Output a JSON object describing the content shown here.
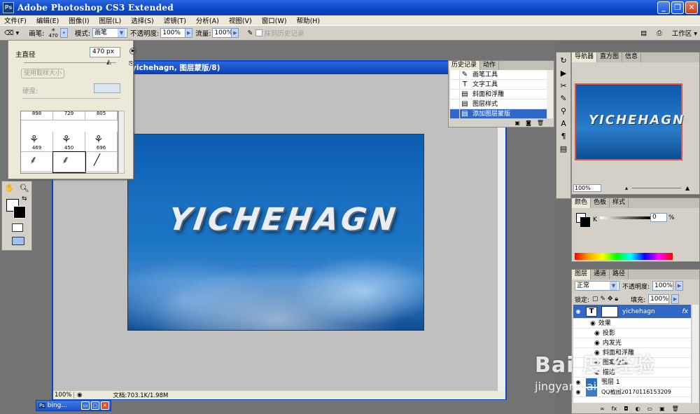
{
  "app": {
    "title": "Adobe Photoshop CS3 Extended",
    "icon_label": "Ps"
  },
  "menu": [
    "文件(F)",
    "编辑(E)",
    "图像(I)",
    "图层(L)",
    "选择(S)",
    "滤镜(T)",
    "分析(A)",
    "视图(V)",
    "窗口(W)",
    "帮助(H)"
  ],
  "options_bar": {
    "brush_label": "画笔:",
    "brush_size": "470",
    "mode_label": "模式:",
    "mode_value": "画笔",
    "opacity_label": "不透明度:",
    "opacity_value": "100%",
    "flow_label": "流量:",
    "flow_value": "100%",
    "erase_history": "抹到历史记录",
    "workspace": "工作区 ▾"
  },
  "brush_popup": {
    "master_diameter_label": "主直径",
    "master_diameter_value": "470 px",
    "use_sample_size": "使用取样大小",
    "hardness_label": "硬度:",
    "top_row": [
      "898",
      "729",
      "805"
    ],
    "rows": [
      {
        "labels": [
          "469",
          "450",
          "696"
        ]
      },
      {
        "labels": [
          "",
          "",
          ""
        ]
      }
    ]
  },
  "document": {
    "title": "yichehagn, 图层蒙版/8)",
    "zoom": "100%",
    "doc_info": "文档:703.1K/1.98M",
    "artwork_text": "YICHEHAGN"
  },
  "history": {
    "tabs": [
      "历史记录",
      "动作"
    ],
    "items": [
      {
        "label": "画笔工具",
        "icon": "brush-icon",
        "selected": false
      },
      {
        "label": "文字工具",
        "icon": "type-icon",
        "selected": false
      },
      {
        "label": "斜面和浮雕",
        "icon": "state-icon",
        "selected": false
      },
      {
        "label": "图层样式",
        "icon": "state-icon",
        "selected": false
      },
      {
        "label": "添加图层蒙版",
        "icon": "state-icon",
        "selected": true
      }
    ]
  },
  "navigator": {
    "tabs": [
      "导航器",
      "直方图",
      "信息"
    ],
    "zoom": "100%",
    "thumb_text": "YICHEHAGN"
  },
  "color_panel": {
    "tabs": [
      "颜色",
      "色板",
      "样式"
    ],
    "k_label": "K",
    "k_value": "0",
    "pct": "%"
  },
  "layers": {
    "tabs": [
      "图层",
      "通道",
      "路径"
    ],
    "blend_mode": "正常",
    "opacity_label": "不透明度:",
    "opacity_value": "100%",
    "lock_label": "锁定:",
    "fill_label": "填充:",
    "fill_value": "100%",
    "items": [
      {
        "name": "yichehagn",
        "type": "text",
        "selected": true
      },
      {
        "name": "效果",
        "type": "effects"
      },
      {
        "name": "投影",
        "type": "effect"
      },
      {
        "name": "内发光",
        "type": "effect"
      },
      {
        "name": "斜面和浮雕",
        "type": "effect"
      },
      {
        "name": "图案叠加",
        "type": "effect"
      },
      {
        "name": "描边",
        "type": "effect"
      },
      {
        "name": "图层 1",
        "type": "layer"
      },
      {
        "name": "QQ截图20170116153209",
        "type": "layer"
      }
    ]
  },
  "taskbar": {
    "item_label": "bing..."
  },
  "watermark": {
    "logo": "Bai 度 经验",
    "url": "jingyan.baidu.com"
  }
}
